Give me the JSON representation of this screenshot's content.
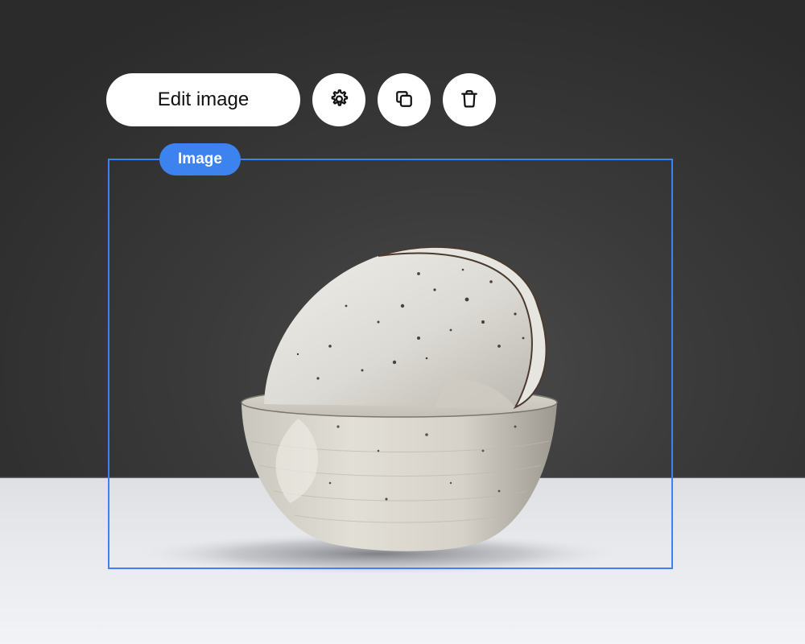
{
  "toolbar": {
    "edit_label": "Edit image",
    "settings_icon": "gear-icon",
    "duplicate_icon": "copy-icon",
    "delete_icon": "trash-icon"
  },
  "selection": {
    "label": "Image",
    "accent_color": "#3d83f0"
  },
  "photo": {
    "subject": "two stacked speckled ceramic bowls"
  }
}
